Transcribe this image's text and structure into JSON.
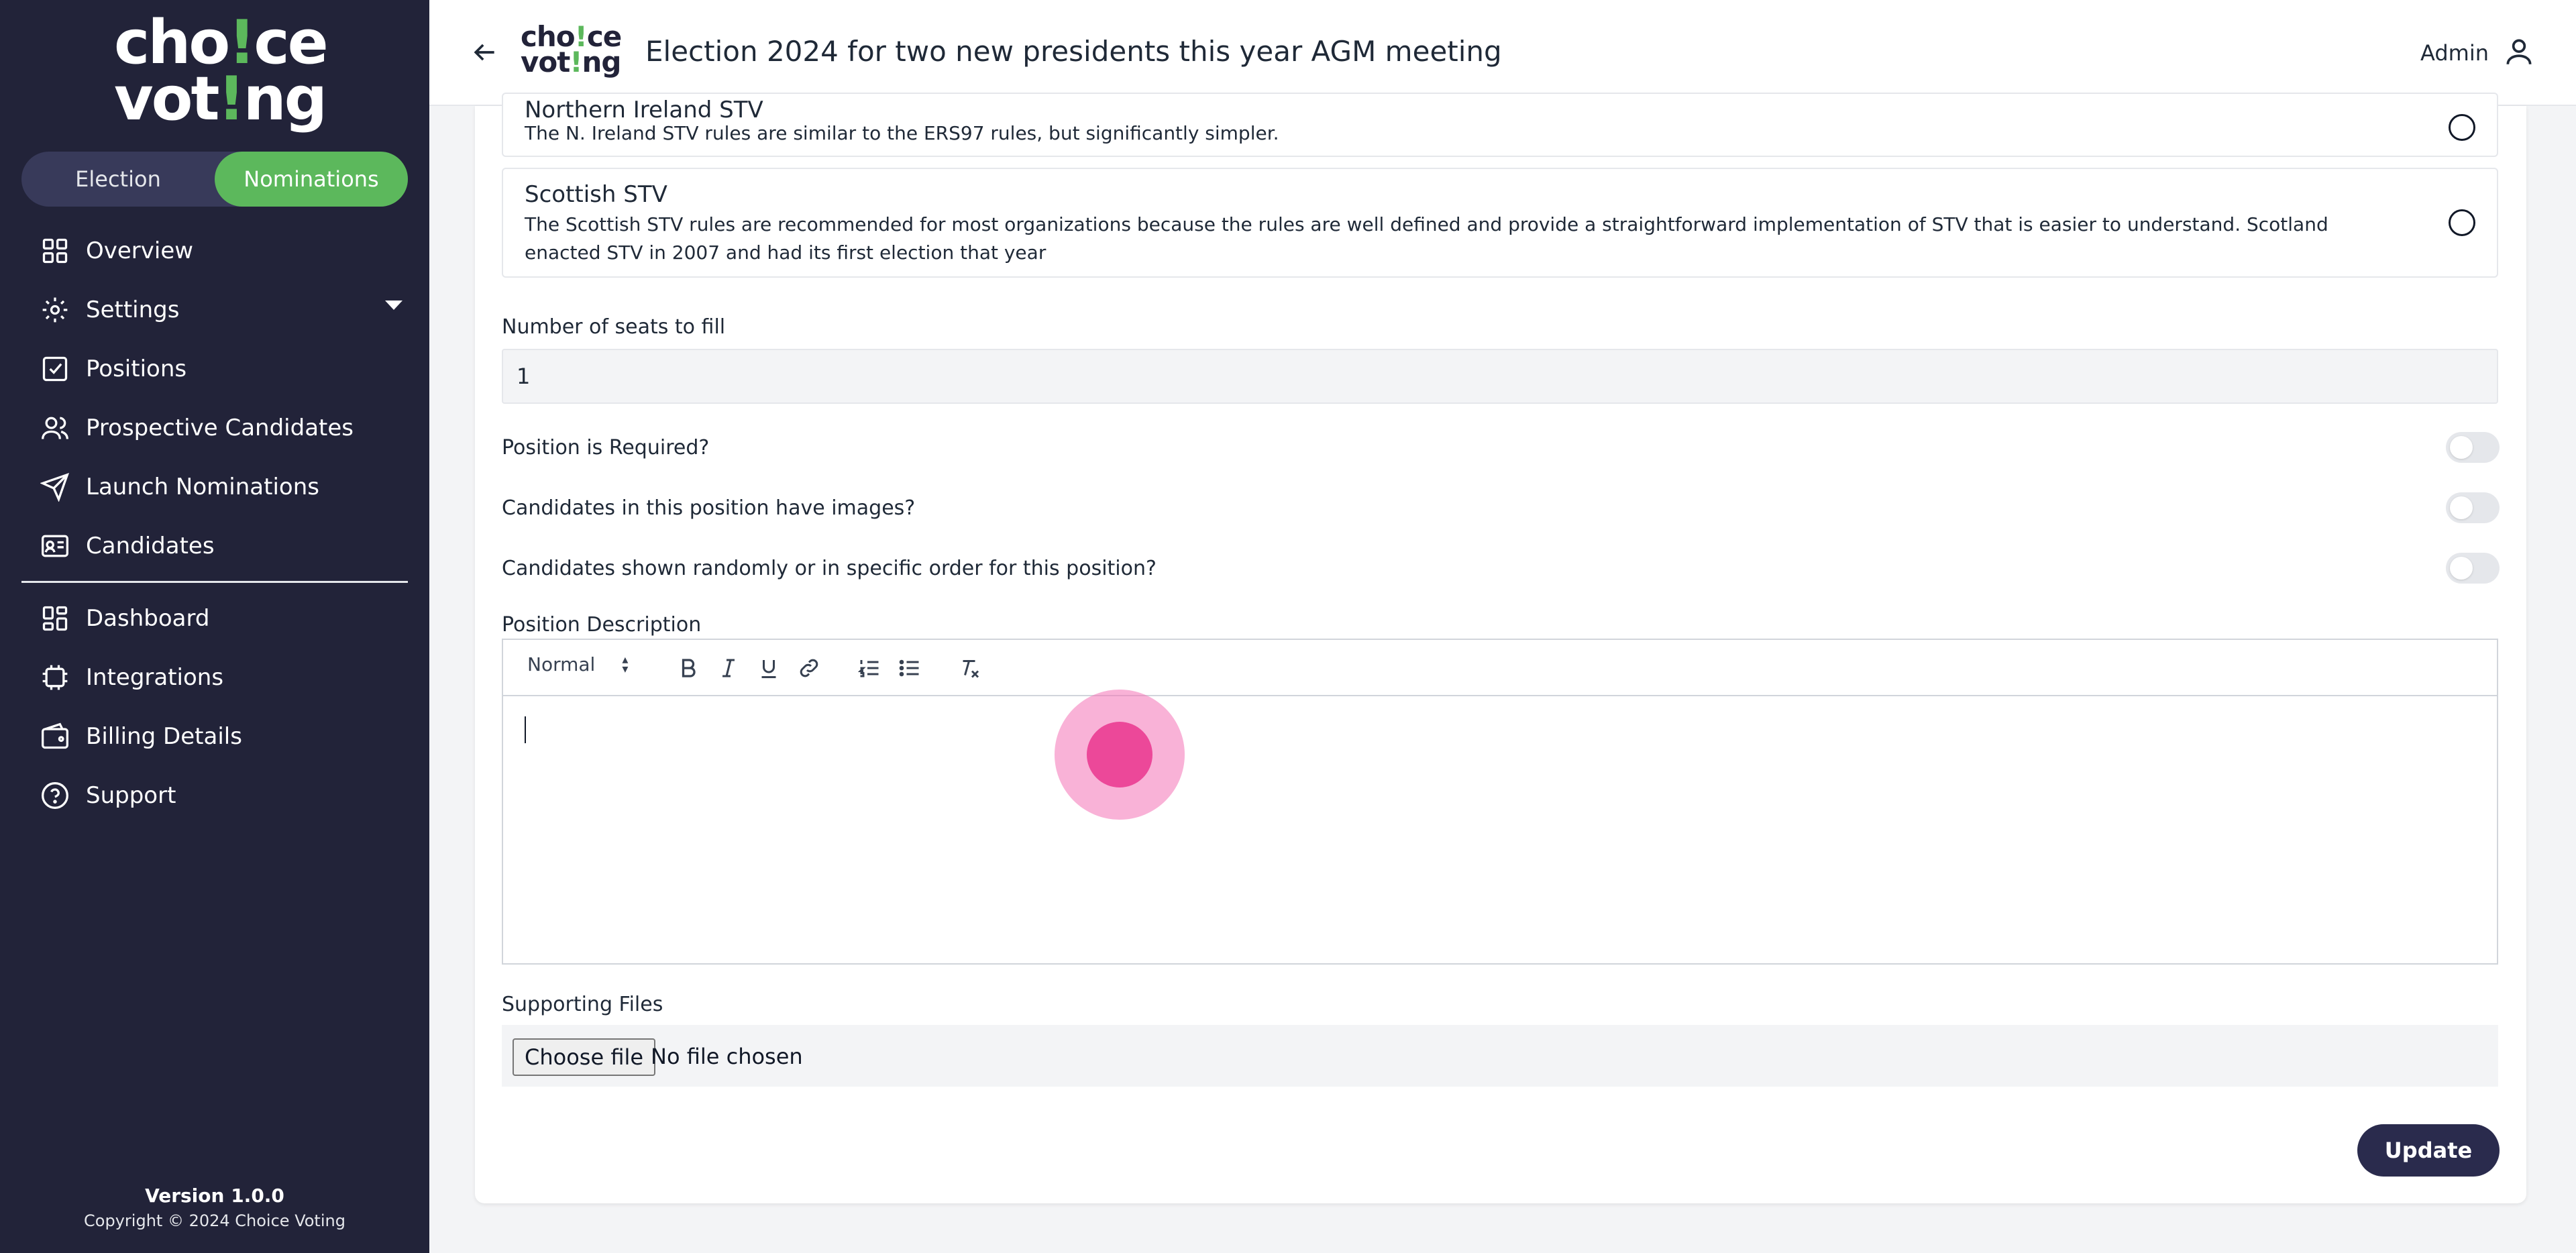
{
  "sidebar": {
    "logo_line1": "cho",
    "logo_line1_bang": "!",
    "logo_line1_end": "ce",
    "logo_line2": "vot",
    "logo_line2_bang": "!",
    "logo_line2_end": "ng",
    "mode_toggle": {
      "election": "Election",
      "nominations": "Nominations",
      "active": "nominations"
    },
    "items": [
      {
        "label": "Overview",
        "icon": "grid-icon"
      },
      {
        "label": "Settings",
        "icon": "gear-icon"
      },
      {
        "label": "Positions",
        "icon": "checkbox-icon"
      },
      {
        "label": "Prospective Candidates",
        "icon": "users-icon"
      },
      {
        "label": "Launch Nominations",
        "icon": "send-icon"
      },
      {
        "label": "Candidates",
        "icon": "id-card-icon"
      },
      {
        "label": "Dashboard",
        "icon": "dashboard-icon"
      },
      {
        "label": "Integrations",
        "icon": "chip-icon"
      },
      {
        "label": "Billing Details",
        "icon": "wallet-icon"
      },
      {
        "label": "Support",
        "icon": "help-circle-icon"
      }
    ],
    "version": "Version 1.0.0",
    "copyright": "Copyright © 2024 Choice Voting"
  },
  "header": {
    "title": "Election 2024 for two new presidents this year AGM meeting",
    "user_label": "Admin"
  },
  "form": {
    "stv_options": [
      {
        "title": "Northern Ireland STV",
        "description": "The N. Ireland STV rules are similar to the ERS97 rules, but significantly simpler."
      },
      {
        "title": "Scottish STV",
        "description": "The Scottish STV rules are recommended for most organizations because the rules are well defined and provide a straightforward implementation of STV that is easier to understand. Scotland enacted STV in 2007 and had its first election that year"
      }
    ],
    "seats_label": "Number of seats to fill",
    "seats_value": "1",
    "required_label": "Position is Required?",
    "images_label": "Candidates in this position have images?",
    "order_label": "Candidates shown randomly or in specific order for this position?",
    "description_label": "Position Description",
    "editor_format": "Normal",
    "files_label": "Supporting Files",
    "file_button": "Choose file",
    "file_status": "No file chosen",
    "update_label": "Update"
  },
  "colors": {
    "sidebar_bg": "#222339",
    "accent_green": "#5cb85c",
    "primary_button": "#2a2b4d",
    "click_indicator": "#ec4899"
  }
}
